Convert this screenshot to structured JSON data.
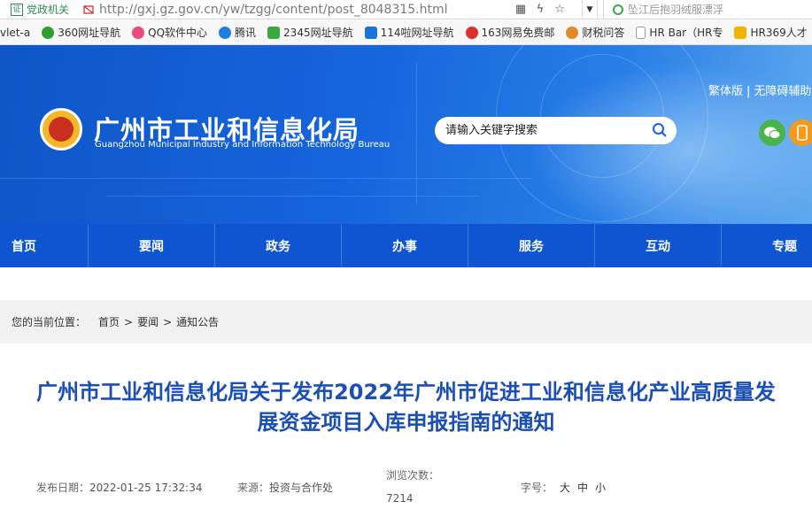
{
  "browser": {
    "badge": "党政机关",
    "url": "http://gxj.gz.gov.cn/yw/tzgg/content/post_8048315.html",
    "search_text": "坠江后抱羽绒服漂浮",
    "bookmarks": [
      {
        "label": "vlet-a",
        "color": "#888888"
      },
      {
        "label": "360网址导航",
        "color": "#2f9e2f"
      },
      {
        "label": "QQ软件中心",
        "color": "#e94b7d"
      },
      {
        "label": "腾讯",
        "color": "#1f7fe0"
      },
      {
        "label": "2345网址导航",
        "color": "#3aa840"
      },
      {
        "label": "114啦网址导航",
        "color": "#1a73d9"
      },
      {
        "label": "163网易免费邮",
        "color": "#d9302b"
      },
      {
        "label": "财税问答",
        "color": "#e08a2a"
      },
      {
        "label": "HR Bar（HR专",
        "color": "#aaaaaa"
      },
      {
        "label": "HR369人才",
        "color": "#f0b400"
      }
    ]
  },
  "header": {
    "org_name_cn": "广州市工业和信息化局",
    "org_name_en": "Guangzhou Municipal Industry and Information Technology Bureau",
    "link_traditional": "繁体版",
    "link_separator": "|",
    "link_accessible": "无障碍辅助",
    "search_placeholder": "请输入关键字搜索"
  },
  "nav": {
    "items": [
      "首页",
      "要闻",
      "政务",
      "办事",
      "服务",
      "互动",
      "专题"
    ]
  },
  "breadcrumb": {
    "prefix": "您的当前位置：",
    "items": [
      "首页",
      "要闻",
      "通知公告"
    ],
    "separator": ">"
  },
  "article": {
    "title_line1": "广州市工业和信息化局关于发布2022年广州市促进工业和信息化产业高质量发",
    "title_line2": "展资金项目入库申报指南的通知",
    "publish_label": "发布日期：",
    "publish_value": "2022-01-25 17:32:34",
    "source_label": "来源：",
    "source_value": "投资与合作处",
    "views_label": "浏览次数：",
    "views_value": "7214",
    "fontsize_label": "字号：",
    "fontsize_options": [
      "大",
      "中",
      "小"
    ]
  },
  "colors": {
    "banner_blue": "#1765dc",
    "nav_blue": "#0f55d2",
    "title_blue": "#1b4fb3"
  }
}
